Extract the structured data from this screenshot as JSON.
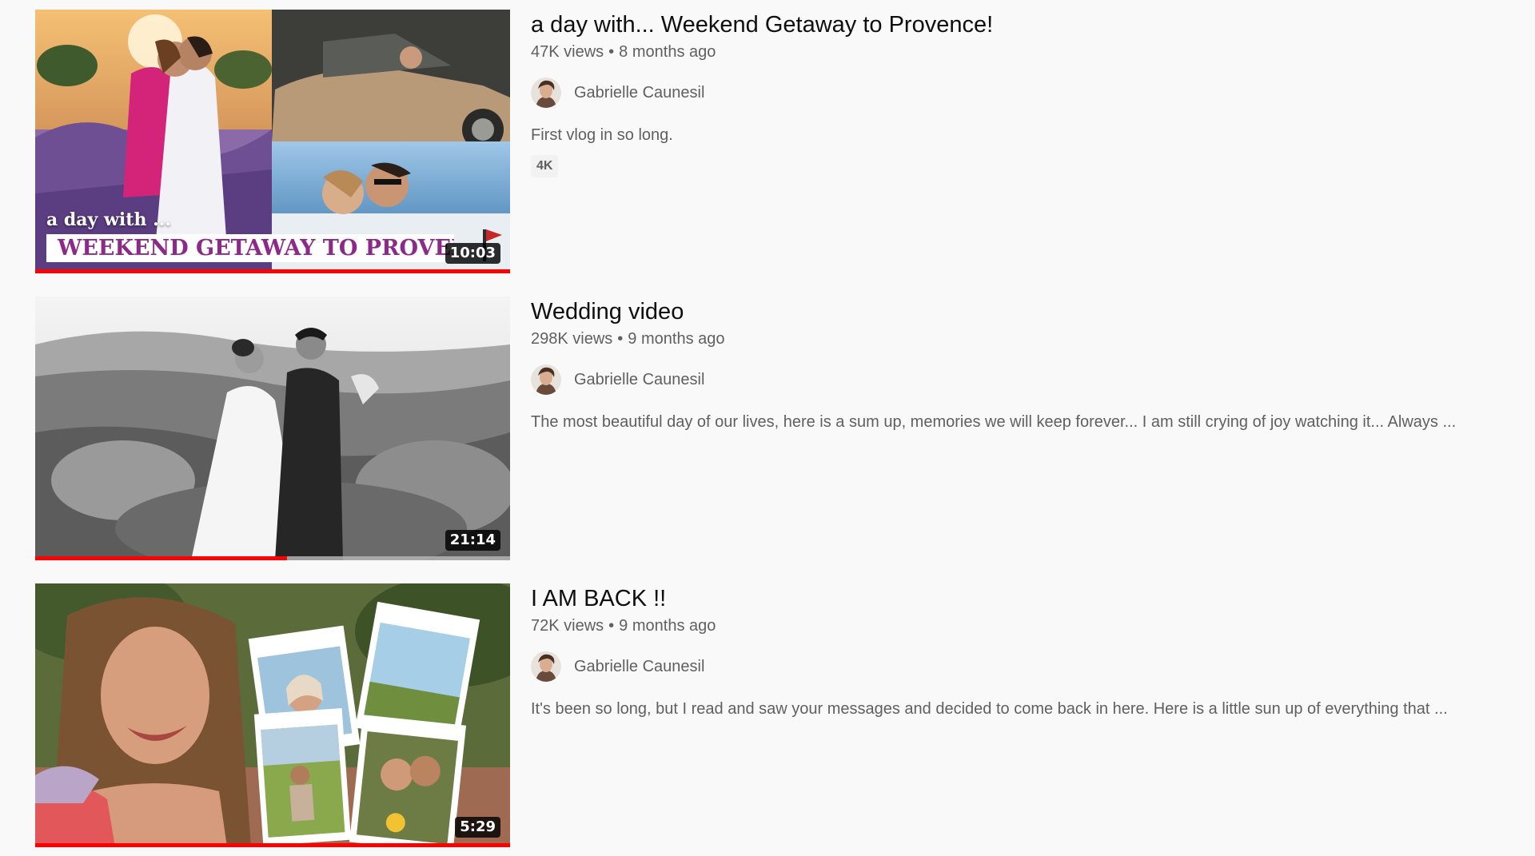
{
  "videos": [
    {
      "title": "a day with... Weekend Getaway to Provence!",
      "views": "47K views",
      "age": "8 months ago",
      "channel": "Gabrielle Caunesil",
      "description": "First vlog in so long.",
      "badge": "4K",
      "duration": "10:03",
      "watched_fraction": 1.0,
      "thumb_overlay_small": "a day with ...",
      "thumb_overlay_band": "WEEKEND GETAWAY TO PROVENCE"
    },
    {
      "title": "Wedding video",
      "views": "298K views",
      "age": "9 months ago",
      "channel": "Gabrielle Caunesil",
      "description": "The most beautiful day of our lives, here is a sum up, memories we will keep forever... I am still crying of joy watching it... Always ...",
      "duration": "21:14",
      "watched_fraction": 0.53
    },
    {
      "title": "I AM BACK !!",
      "views": "72K views",
      "age": "9 months ago",
      "channel": "Gabrielle Caunesil",
      "description": "It's been so long, but I read and saw your messages and decided to come back in here. Here is a little sun up of everything that ...",
      "duration": "5:29",
      "watched_fraction": 1.0
    }
  ],
  "separator": "•",
  "colors": {
    "progress": "#ff0000",
    "background": "#f9f9f9",
    "secondary_text": "#606060",
    "overlay_title": "#8c2a8a"
  }
}
